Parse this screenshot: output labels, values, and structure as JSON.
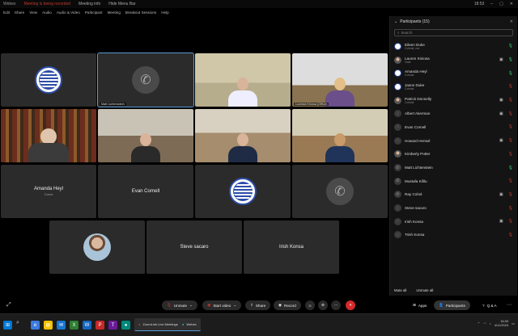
{
  "titlebar": {
    "title": "Webex",
    "warning": "Meeting is being recorded",
    "right_items": [
      "Meeting info",
      "Hide Menu Bar"
    ],
    "time": "18:53"
  },
  "menubar": [
    "Edit",
    "Share",
    "View",
    "Audio",
    "Audio & Video",
    "Participant",
    "Meeting",
    "Breakout Sessions",
    "Help"
  ],
  "tiles": [
    {
      "id": "seal-1",
      "kind": "seal"
    },
    {
      "id": "phone-1",
      "kind": "phone",
      "caption": "Matt Lichtenstein",
      "active": true
    },
    {
      "id": "video-1",
      "kind": "video",
      "style": "v-office1"
    },
    {
      "id": "video-2",
      "kind": "video",
      "style": "v-office2",
      "caption": "Lucinda Kinosa (Office)"
    },
    {
      "id": "video-3",
      "kind": "video",
      "style": "v-books"
    },
    {
      "id": "video-4",
      "kind": "video",
      "style": "v-room1"
    },
    {
      "id": "video-5",
      "kind": "video",
      "style": "v-room2"
    },
    {
      "id": "video-6",
      "kind": "video",
      "style": "v-room3"
    },
    {
      "id": "name-amanda",
      "kind": "name",
      "name": "Amanda Heyl",
      "sub": "Guest"
    },
    {
      "id": "name-evan",
      "kind": "name",
      "name": "Evan Cornell"
    },
    {
      "id": "seal-2",
      "kind": "seal"
    },
    {
      "id": "phone-2",
      "kind": "phone"
    },
    {
      "id": "avatar-1",
      "kind": "avatar"
    },
    {
      "id": "name-steve",
      "kind": "name",
      "name": "Steve sacaro"
    },
    {
      "id": "name-irish",
      "kind": "name",
      "name": "Irish Konsa"
    }
  ],
  "panel": {
    "title": "Participants (15)",
    "search_placeholder": "Search",
    "participants": [
      {
        "name": "Eileen Duke",
        "sub": "Cohost, me",
        "avatar": "seal",
        "video": false,
        "mic": "on"
      },
      {
        "name": "Lauren Kiniosa",
        "sub": "Host",
        "avatar": "photo",
        "video": true,
        "mic": "on"
      },
      {
        "name": "Amanda Heyl",
        "sub": "Cohost",
        "avatar": "seal",
        "video": false,
        "mic": "on"
      },
      {
        "name": "Jason Duke",
        "sub": "Cohost",
        "avatar": "seal",
        "video": false,
        "mic": "off"
      },
      {
        "name": "Patrick Donnelly",
        "sub": "Cohost",
        "avatar": "photo",
        "video": true,
        "mic": "off"
      },
      {
        "name": "Albert Akerman",
        "sub": "",
        "avatar": "blank",
        "video": true,
        "mic": "off"
      },
      {
        "name": "Evan Cornell",
        "sub": "",
        "avatar": "blank",
        "video": false,
        "mic": "off"
      },
      {
        "name": "Howard Hensel",
        "sub": "",
        "avatar": "blank",
        "video": true,
        "mic": "off"
      },
      {
        "name": "Kimberly Potter",
        "sub": "",
        "avatar": "photo",
        "video": false,
        "mic": "off"
      },
      {
        "name": "Matt Lichtenstein",
        "sub": "",
        "avatar": "phone",
        "video": false,
        "mic": "on"
      },
      {
        "name": "Mustafa Kifilu",
        "sub": "",
        "avatar": "phone",
        "video": false,
        "mic": "off"
      },
      {
        "name": "Ray Cohol",
        "sub": "",
        "avatar": "phone",
        "video": true,
        "mic": "off"
      },
      {
        "name": "Steve sacaro",
        "sub": "",
        "avatar": "blank",
        "video": false,
        "mic": "off"
      },
      {
        "name": "Irish Konsa",
        "sub": "",
        "avatar": "blank",
        "video": true,
        "mic": "off"
      },
      {
        "name": "Trish Konsa",
        "sub": "",
        "avatar": "blank",
        "video": false,
        "mic": "off"
      }
    ],
    "footer_left": "Mute all",
    "footer_right": "Unmute all"
  },
  "controls": {
    "unmute": "Unmute",
    "start_video": "Start video",
    "share": "Share",
    "record": "Record",
    "apps": "Apps",
    "participants": "Participants",
    "qa": "Q & A"
  },
  "taskbar": {
    "app1": "ZoomLink Live Meetings...",
    "app2": "Webex",
    "time": "18:53",
    "date": "4/11/2024"
  }
}
